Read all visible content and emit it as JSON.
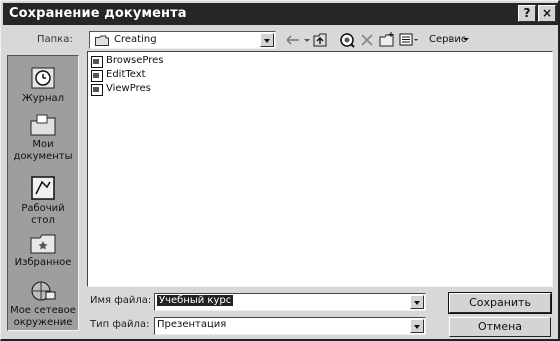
{
  "window": {
    "title": "Сохранение документа",
    "help_button": "?",
    "close_button": "×"
  },
  "toolbar": {
    "look_in_label": "Папка:",
    "current_folder": "Creating",
    "service_menu": "Сервис"
  },
  "places": [
    {
      "id": "journal",
      "label": "Журнал",
      "icon": "history-journal-icon"
    },
    {
      "id": "my-documents",
      "label": "Мои документы",
      "icon": "my-documents-folder-icon"
    },
    {
      "id": "desktop",
      "label": "Рабочий стол",
      "icon": "desktop-icon"
    },
    {
      "id": "favorites",
      "label": "Избранное",
      "icon": "favorites-folder-icon"
    },
    {
      "id": "network",
      "label": "Мое сетевое окружение",
      "icon": "network-places-icon"
    }
  ],
  "files": [
    {
      "name": "BrowsePres",
      "icon": "presentation-file-icon"
    },
    {
      "name": "EditText",
      "icon": "presentation-file-icon"
    },
    {
      "name": "ViewPres",
      "icon": "presentation-file-icon"
    }
  ],
  "filename": {
    "label": "Имя файла:",
    "value": "Учебный курс"
  },
  "filetype": {
    "label": "Тип файла:",
    "value": "Презентация"
  },
  "buttons": {
    "save": "Сохранить",
    "cancel": "Отмена"
  }
}
